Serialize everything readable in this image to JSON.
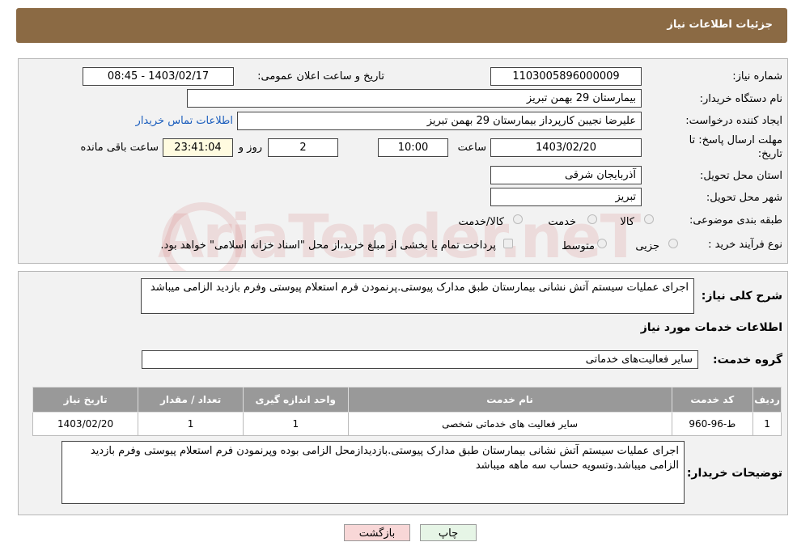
{
  "header": {
    "title": "جزئیات اطلاعات نیاز"
  },
  "fields": {
    "need_number_label": "شماره نیاز:",
    "need_number": "1103005896000009",
    "announce_label": "تاریخ و ساعت اعلان عمومی:",
    "announce_value": "1403/02/17 - 08:45",
    "buyer_label": "نام دستگاه خریدار:",
    "buyer_value": "بیمارستان 29 بهمن تبریز",
    "creator_label": "ایجاد کننده درخواست:",
    "creator_value": "علیرضا نجیبن کارپرداز بیمارستان 29 بهمن تبریز",
    "contact_link": "اطلاعات تماس خریدار",
    "deadline_label_1": "مهلت ارسال پاسخ: تا",
    "deadline_label_2": "تاریخ:",
    "deadline_date": "1403/02/20",
    "time_label": "ساعت",
    "deadline_time": "10:00",
    "days_value": "2",
    "days_label": "روز و",
    "remaining_time": "23:41:04",
    "remaining_label": "ساعت باقی مانده",
    "province_label": "استان محل تحویل:",
    "province_value": "آذربایجان شرقی",
    "city_label": "شهر محل تحویل:",
    "city_value": "تبریز",
    "category_label": "طبقه بندی موضوعی:",
    "category_options": [
      "کالا",
      "خدمت",
      "کالا/خدمت"
    ],
    "process_label": "نوع فرآیند خرید :",
    "process_options": [
      "جزیی",
      "متوسط"
    ],
    "process_note": "پرداخت تمام یا بخشی از مبلغ خرید،از محل \"اسناد خزانه اسلامی\" خواهد بود."
  },
  "summary": {
    "label": "شرح کلی نیاز:",
    "text": "اجرای عملیات سیستم آتش نشانی بیمارستان طبق مدارک پیوستی.پرنمودن فرم استعلام پیوستی وفرم بازدید الزامی میباشد"
  },
  "services": {
    "section_title": "اطلاعات خدمات مورد نیاز",
    "group_label": "گروه خدمت:",
    "group_value": "سایر فعالیت‌های خدماتی",
    "columns": [
      "ردیف",
      "کد خدمت",
      "نام خدمت",
      "واحد اندازه گیری",
      "تعداد / مقدار",
      "تاریخ نیاز"
    ],
    "rows": [
      [
        "1",
        "ط-96-960",
        "سایر فعالیت های خدماتی شخصی",
        "1",
        "1",
        "1403/02/20"
      ]
    ]
  },
  "buyer_notes": {
    "label": "توضیحات خریدار:",
    "text": "اجرای عملیات سیستم آتش نشانی بیمارستان طبق مدارک پیوستی.بازدیدازمحل الزامی بوده وپرنمودن فرم استعلام پیوستی وفرم بازدید الزامی میباشد.وتسویه حساب سه ماهه میباشد"
  },
  "buttons": {
    "print": "چاپ",
    "back": "بازگشت"
  },
  "watermark": "AriaTender.neT",
  "colors": {
    "header_bg": "#8b6a44",
    "back_btn": "#f8d7d7",
    "print_btn": "#e6f5e6",
    "link": "#1a5dbd"
  }
}
